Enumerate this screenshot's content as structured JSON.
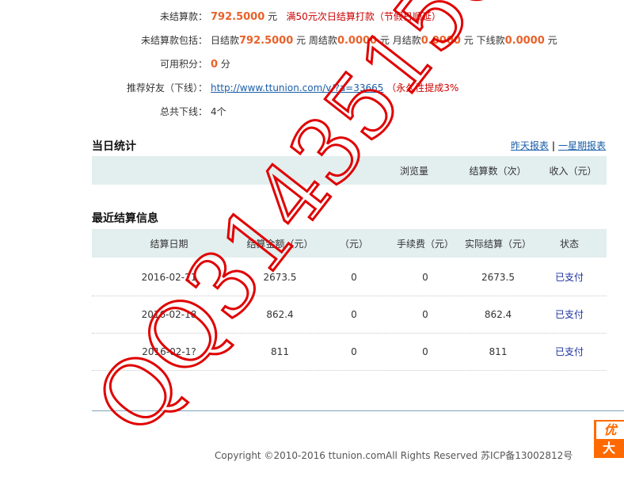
{
  "account": {
    "unsettled_label": "未结算款：",
    "unsettled_amount": "792.5000",
    "unsettled_unit": " 元",
    "unsettled_note": "满50元次日结算打款（节假日顺延）",
    "breakdown_label": "未结算款包括：",
    "daily_label": "日结款",
    "daily_amount": "792.5000",
    "daily_unit": " 元 ",
    "weekly_label": "周结款",
    "weekly_amount": "0.0000",
    "weekly_unit": " 元 ",
    "monthly_label": "月结款",
    "monthly_amount": "0.0000",
    "monthly_unit": " 元 ",
    "downline_label": "下线款",
    "downline_amount": "0.0000",
    "downline_unit": " 元",
    "points_label": "可用积分：",
    "points_value": "0",
    "points_unit": " 分",
    "referral_label": "推荐好友（下线）：",
    "referral_link": "http://www.ttunion.com/v/?a=33665",
    "referral_note": "（永久性提成3%",
    "total_downline_label": "总共下线：",
    "total_downline_value": "4个"
  },
  "daily_stats": {
    "title": "当日统计",
    "link_yesterday": "昨天报表",
    "separator": "|",
    "link_week": "一星期报表",
    "headers": [
      "浏览量",
      "结算数（次）",
      "收入（元）"
    ]
  },
  "settlements": {
    "title": "最近结算信息",
    "headers": [
      "结算日期",
      "结算金额（元）",
      "（元）",
      "手续费（元）",
      "实际结算（元）",
      "状态"
    ],
    "rows": [
      {
        "date": "2016-02-21",
        "amount": "2673.5",
        "col3": "0",
        "fee": "0",
        "actual": "2673.5",
        "status": "已支付"
      },
      {
        "date": "2016-02-18",
        "amount": "862.4",
        "col3": "0",
        "fee": "0",
        "actual": "862.4",
        "status": "已支付"
      },
      {
        "date": "2016-02-1?",
        "amount": "811",
        "col3": "0",
        "fee": "0",
        "actual": "811",
        "status": "已支付"
      }
    ]
  },
  "footer": {
    "copyright": "Copyright ©2010-2016 ttunion.comAll Rights Reserved  苏ICP备13002812号"
  },
  "ad": {
    "top_text": "优",
    "bottom_text": "大"
  },
  "watermark": {
    "text": "QQ314351505",
    "color": "#e00000"
  }
}
